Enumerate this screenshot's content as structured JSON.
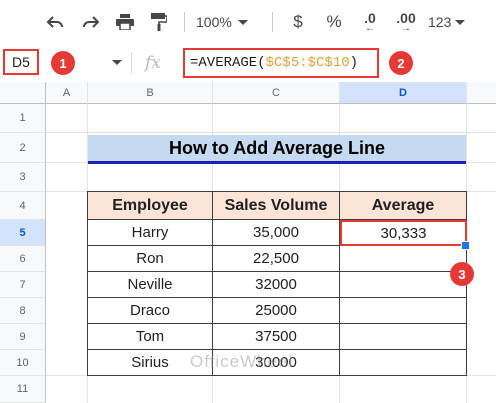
{
  "toolbar": {
    "zoom": "100%",
    "currency": "$",
    "percent": "%",
    "decrease_decimal": ".0",
    "increase_decimal": ".00",
    "more_formats": "123"
  },
  "formula_bar": {
    "name_box": "D5",
    "fx": "fx",
    "formula_prefix": "=AVERAGE(",
    "formula_range": "$C$5:$C$10",
    "formula_suffix": ")"
  },
  "badges": [
    "1",
    "2",
    "3"
  ],
  "columns": [
    "A",
    "B",
    "C",
    "D"
  ],
  "rows": [
    "1",
    "2",
    "3",
    "4",
    "5",
    "6",
    "7",
    "8",
    "9",
    "10",
    "11"
  ],
  "sheet": {
    "title": "How to Add Average Line",
    "headers": [
      "Employee",
      "Sales Volume",
      "Average"
    ],
    "data": [
      {
        "employee": "Harry",
        "sales": "35,000",
        "average": "30,333"
      },
      {
        "employee": "Ron",
        "sales": "22,500",
        "average": ""
      },
      {
        "employee": "Neville",
        "sales": "32000",
        "average": ""
      },
      {
        "employee": "Draco",
        "sales": "25000",
        "average": ""
      },
      {
        "employee": "Tom",
        "sales": "37500",
        "average": ""
      },
      {
        "employee": "Sirius",
        "sales": "30000",
        "average": ""
      }
    ]
  },
  "watermark": "OfficeWheel",
  "colors": {
    "accent_red": "#e53935",
    "header_fill": "#fce4d6",
    "title_fill": "#c5d9f1",
    "title_underline": "#1f1fbf",
    "selection": "#1a73e8"
  }
}
